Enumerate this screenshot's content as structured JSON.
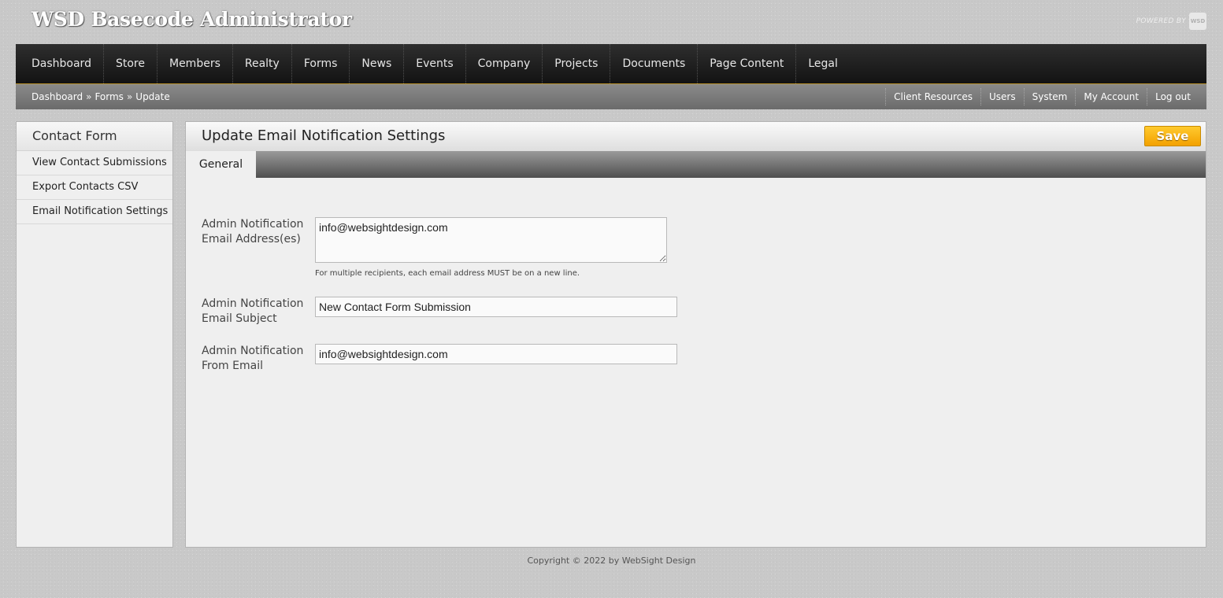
{
  "app": {
    "title": "WSD Basecode Administrator",
    "powered_by": "POWERED BY",
    "logo_text": "WSD"
  },
  "nav": {
    "items": [
      "Dashboard",
      "Store",
      "Members",
      "Realty",
      "Forms",
      "News",
      "Events",
      "Company",
      "Projects",
      "Documents",
      "Page Content",
      "Legal"
    ]
  },
  "breadcrumb": {
    "items": [
      "Dashboard",
      "Forms",
      "Update"
    ],
    "separator": "»"
  },
  "utility_nav": {
    "items": [
      "Client Resources",
      "Users",
      "System",
      "My Account",
      "Log out"
    ]
  },
  "sidebar": {
    "title": "Contact Form",
    "links": [
      "View Contact Submissions",
      "Export Contacts CSV",
      "Email Notification Settings"
    ]
  },
  "main": {
    "title": "Update Email Notification Settings",
    "save_label": "Save",
    "tabs": [
      "General"
    ],
    "fields": {
      "emails": {
        "label_line1": "Admin Notification",
        "label_line2": "Email Address(es)",
        "value": "info@websightdesign.com",
        "hint": "For multiple recipients, each email address MUST be on a new line."
      },
      "subject": {
        "label_line1": "Admin Notification",
        "label_line2": "Email Subject",
        "value": "New Contact Form Submission"
      },
      "from": {
        "label_line1": "Admin Notification",
        "label_line2": "From Email",
        "value": "info@websightdesign.com"
      }
    }
  },
  "footer": {
    "copyright": "Copyright © 2022 by WebSight Design"
  },
  "colors": {
    "save_button": "#f5a900",
    "nav_background": "#1e1e1e",
    "nav_accent_line": "#b8902a"
  }
}
